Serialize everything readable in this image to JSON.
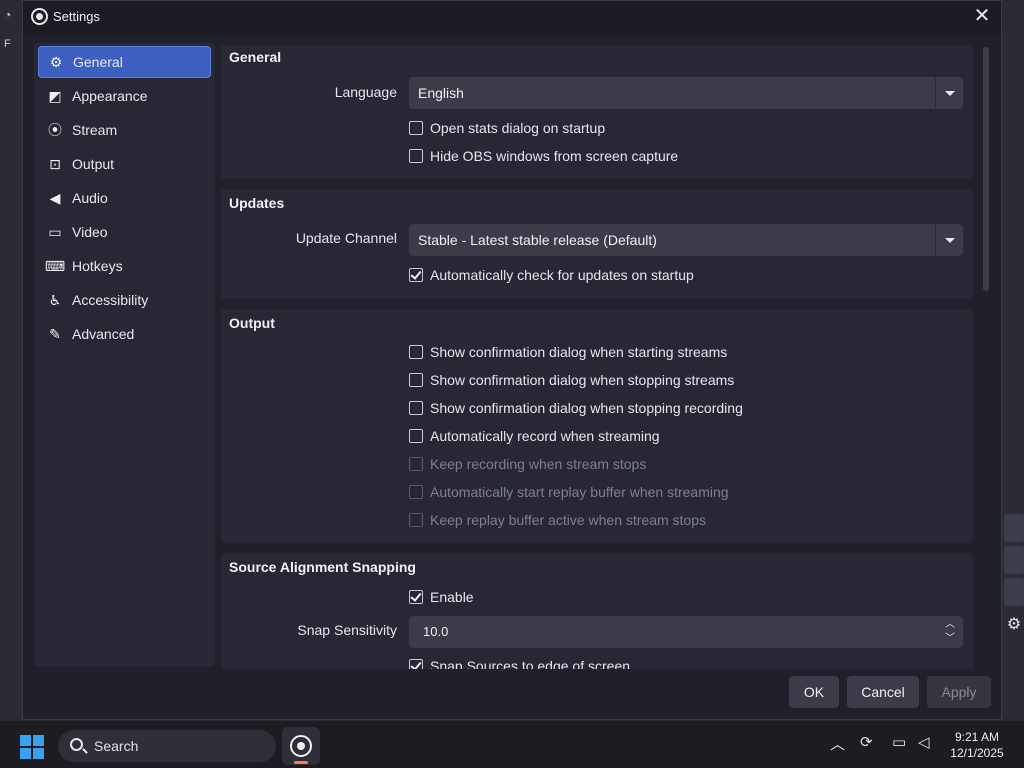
{
  "window": {
    "title": "Settings",
    "close_glyph": "✕"
  },
  "sidebar": {
    "items": [
      {
        "label": "General",
        "icon": "gear-icon",
        "active": true
      },
      {
        "label": "Appearance",
        "icon": "appearance-icon",
        "active": false
      },
      {
        "label": "Stream",
        "icon": "antenna-icon",
        "active": false
      },
      {
        "label": "Output",
        "icon": "output-icon",
        "active": false
      },
      {
        "label": "Audio",
        "icon": "speaker-icon",
        "active": false
      },
      {
        "label": "Video",
        "icon": "monitor-icon",
        "active": false
      },
      {
        "label": "Hotkeys",
        "icon": "keyboard-icon",
        "active": false
      },
      {
        "label": "Accessibility",
        "icon": "accessibility-icon",
        "active": false
      },
      {
        "label": "Advanced",
        "icon": "wrench-icon",
        "active": false
      }
    ]
  },
  "general": {
    "title": "General",
    "language_label": "Language",
    "language_value": "English",
    "open_stats": "Open stats dialog on startup",
    "hide_obs": "Hide OBS windows from screen capture"
  },
  "updates": {
    "title": "Updates",
    "channel_label": "Update Channel",
    "channel_value": "Stable - Latest stable release (Default)",
    "auto_check": "Automatically check for updates on startup"
  },
  "output": {
    "title": "Output",
    "items": [
      {
        "label": "Show confirmation dialog when starting streams",
        "checked": false,
        "disabled": false
      },
      {
        "label": "Show confirmation dialog when stopping streams",
        "checked": false,
        "disabled": false
      },
      {
        "label": "Show confirmation dialog when stopping recording",
        "checked": false,
        "disabled": false
      },
      {
        "label": "Automatically record when streaming",
        "checked": false,
        "disabled": false
      },
      {
        "label": "Keep recording when stream stops",
        "checked": false,
        "disabled": true
      },
      {
        "label": "Automatically start replay buffer when streaming",
        "checked": false,
        "disabled": true
      },
      {
        "label": "Keep replay buffer active when stream stops",
        "checked": false,
        "disabled": true
      }
    ]
  },
  "snapping": {
    "title": "Source Alignment Snapping",
    "enable": "Enable",
    "sensitivity_label": "Snap Sensitivity",
    "sensitivity_value": "10.0",
    "snap_edge": "Snap Sources to edge of screen"
  },
  "buttons": {
    "ok": "OK",
    "cancel": "Cancel",
    "apply": "Apply"
  },
  "taskbar": {
    "search": "Search",
    "time": "9:21 AM",
    "date": "12/1/2025"
  }
}
